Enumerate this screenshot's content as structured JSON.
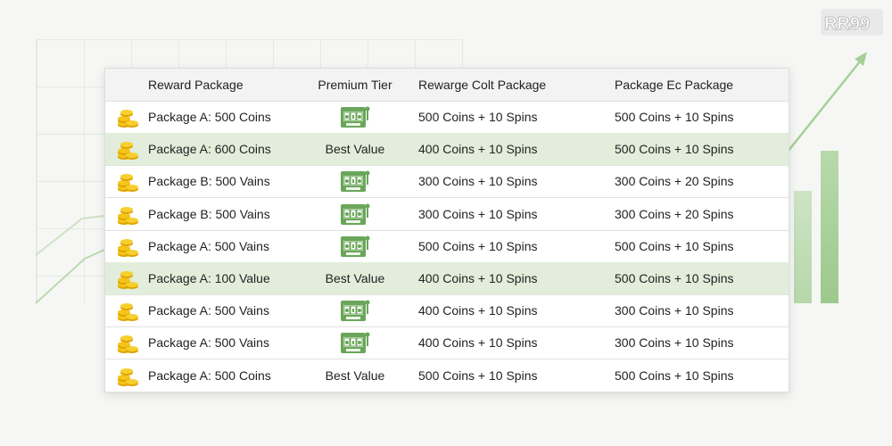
{
  "logo": {
    "text": "RR99"
  },
  "table": {
    "headers": [
      "Reward Package",
      "Premium Tier",
      "Rewarge Colt Package",
      "Package Ec Package"
    ],
    "rows": [
      {
        "name": "Package A: 500 Coins",
        "tier": "",
        "tier_icon": "slot-machine-icon",
        "colt": "500 Coins + 10 Spins",
        "ec": "500 Coins + 10 Spins",
        "highlight": false
      },
      {
        "name": "Package A: 600 Coins",
        "tier": "Best Value",
        "tier_icon": "",
        "colt": "400 Coins + 10 Spins",
        "ec": "500 Coins + 10 Spins",
        "highlight": true
      },
      {
        "name": "Package B: 500 Vains",
        "tier": "",
        "tier_icon": "slot-machine-icon",
        "colt": "300 Coins + 10 Spins",
        "ec": "300 Coins + 20 Spins",
        "highlight": false
      },
      {
        "name": "Package B: 500 Vains",
        "tier": "",
        "tier_icon": "slot-machine-icon",
        "colt": "300 Coins + 10 Spins",
        "ec": "300 Coins + 20 Spins",
        "highlight": false
      },
      {
        "name": "Package A: 500 Vains",
        "tier": "",
        "tier_icon": "slot-machine-icon",
        "colt": "500 Coins + 10 Spins",
        "ec": "500 Coins + 10 Spins",
        "highlight": false
      },
      {
        "name": "Package A: 100 Value",
        "tier": "Best Value",
        "tier_icon": "",
        "colt": "400 Coins + 10 Spins",
        "ec": "500 Coins + 10 Spins",
        "highlight": true
      },
      {
        "name": "Package A: 500 Vains",
        "tier": "",
        "tier_icon": "slot-machine-icon",
        "colt": "400 Coins + 10 Spins",
        "ec": "300 Coins + 10 Spins",
        "highlight": false
      },
      {
        "name": "Package A: 500 Vains",
        "tier": "",
        "tier_icon": "slot-machine-icon",
        "colt": "400 Coins + 10 Spins",
        "ec": "300 Coins + 10 Spins",
        "highlight": false
      },
      {
        "name": "Package A: 500 Coins",
        "tier": "Best Value",
        "tier_icon": "",
        "colt": "500 Coins + 10 Spins",
        "ec": "500 Coins + 10 Spins",
        "highlight": false
      }
    ]
  },
  "colors": {
    "accent_green": "#5a9a48",
    "highlight_row": "#e2eedb",
    "coin_gold": "#f2b705"
  }
}
